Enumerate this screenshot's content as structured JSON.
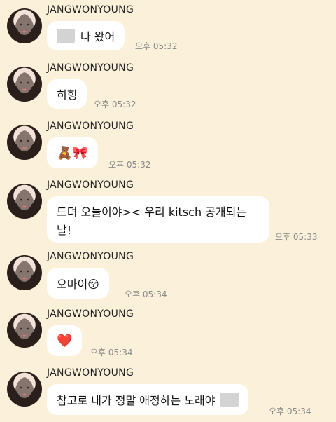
{
  "sender": "JANGWONYOUNG",
  "messages": [
    {
      "text": "나 왔어",
      "time": "오후 05:32",
      "has_blur_prefix": true
    },
    {
      "text": "히힝",
      "time": "오후 05:32"
    },
    {
      "text": "🧸🎀",
      "time": "오후 05:32"
    },
    {
      "text_line1": "드뎌 오늘이야>< 우리 kitsch 공개되는",
      "text_line2": "날!",
      "time": "오후 05:33"
    },
    {
      "text": "오마이😚",
      "time": "오후 05:34"
    },
    {
      "text": "❤️",
      "time": "오후 05:34"
    },
    {
      "text": "참고로 내가 정말 애정하는 노래야",
      "time": "오후 05:34",
      "has_blur_suffix": true
    }
  ],
  "colors": {
    "background": "#fbf0d9",
    "bubble": "#ffffff",
    "time": "#8a8a8a"
  }
}
